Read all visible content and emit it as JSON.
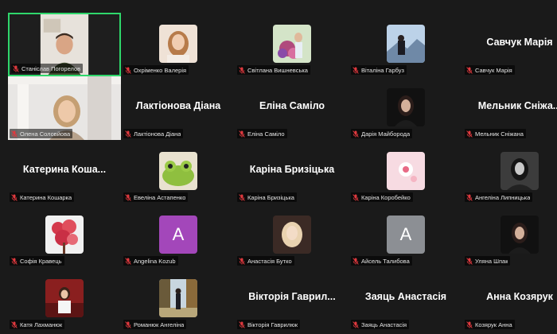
{
  "colors": {
    "background": "#1a1a1a",
    "speaker_border": "#2fd76b",
    "mic_muted": "#e0393e",
    "letter_avatar_purple": "#a347ba",
    "letter_avatar_gray": "#8c8f94"
  },
  "participants": [
    {
      "label": "Станіслав Погорелов",
      "kind": "video",
      "speaking": true
    },
    {
      "label": "Охріменко Валерія",
      "kind": "photo",
      "icon": "woman-photo-icon"
    },
    {
      "label": "Світлана Вишневська",
      "kind": "photo",
      "icon": "flowers-photo-icon"
    },
    {
      "label": "Віталіна Гарбуз",
      "kind": "photo",
      "icon": "landscape-photo-icon"
    },
    {
      "label": "Савчук Марія",
      "kind": "name",
      "display": "Савчук Марія"
    },
    {
      "label": "Олена Соловйова",
      "kind": "video",
      "speaking": false
    },
    {
      "label": "Лактіонова Діана",
      "kind": "name",
      "display": "Лактіонова Діана"
    },
    {
      "label": "Еліна Саміло",
      "kind": "name",
      "display": "Еліна Саміло"
    },
    {
      "label": "Дарія Майборода",
      "kind": "photo",
      "icon": "dark-portrait-icon"
    },
    {
      "label": "Мельник Сніжана",
      "kind": "name",
      "display": "Мельник Сніжа..."
    },
    {
      "label": "Катерина Кошарка",
      "kind": "name",
      "display": "Катерина Коша..."
    },
    {
      "label": "Евеліна Астапенко",
      "kind": "photo",
      "icon": "frog-photo-icon"
    },
    {
      "label": "Каріна Бризіцька",
      "kind": "name",
      "display": "Каріна Бризіцька"
    },
    {
      "label": "Каріна Коробейко",
      "kind": "photo",
      "icon": "pink-flower-icon"
    },
    {
      "label": "Ангеліна Липницька",
      "kind": "photo",
      "icon": "bw-portrait-icon"
    },
    {
      "label": "Софія Кравець",
      "kind": "photo",
      "icon": "red-blossom-icon"
    },
    {
      "label": "Angelina Kozub",
      "kind": "letter",
      "letter": "A",
      "color": "#a347ba"
    },
    {
      "label": "Анастасія Бутко",
      "kind": "photo",
      "icon": "blurred-portrait-icon"
    },
    {
      "label": "Айсель Талибова",
      "kind": "letter",
      "letter": "A",
      "color": "#8c8f94"
    },
    {
      "label": "Уляна Шпак",
      "kind": "photo",
      "icon": "dark-portrait-icon"
    },
    {
      "label": "Катя Лахманюк",
      "kind": "photo",
      "icon": "red-room-portrait-icon"
    },
    {
      "label": "Романюк Ангеліна",
      "kind": "photo",
      "icon": "autumn-park-icon"
    },
    {
      "label": "Вікторія Гаврилюк",
      "kind": "name",
      "display": "Вікторія Гаврил..."
    },
    {
      "label": "Заяць Анастасія",
      "kind": "name",
      "display": "Заяць Анастасія"
    },
    {
      "label": "Козярук Анна",
      "kind": "name",
      "display": "Анна Козярук"
    }
  ]
}
